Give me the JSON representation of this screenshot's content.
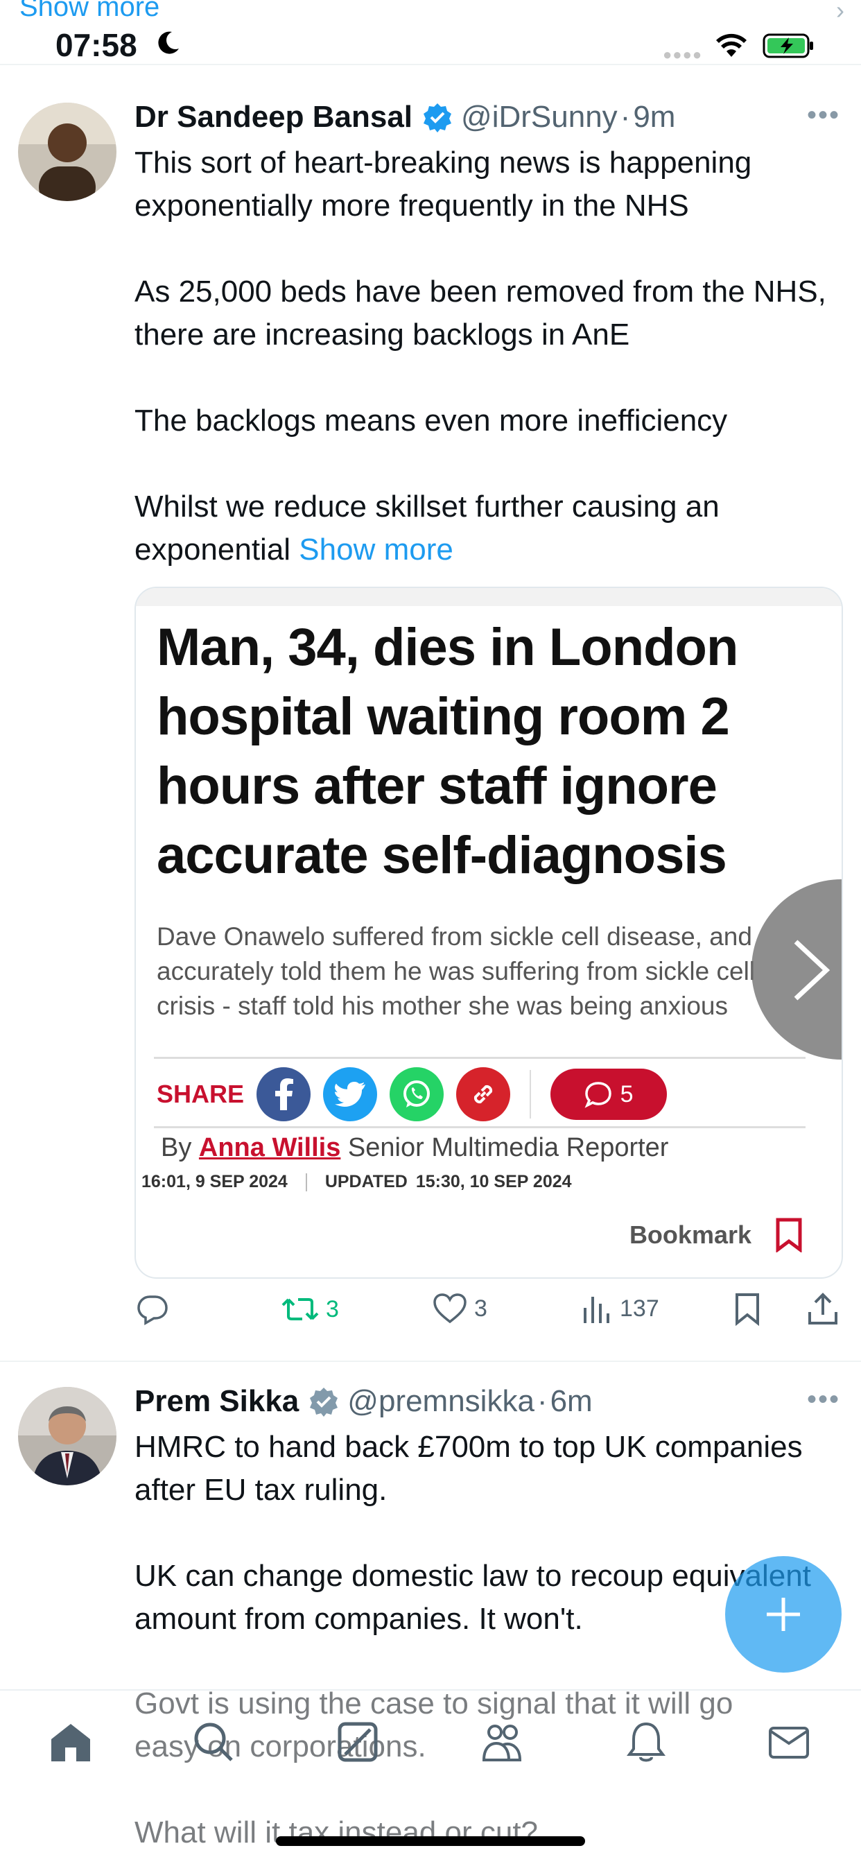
{
  "top_peek": {
    "show_more": "Show more"
  },
  "status_bar": {
    "time": "07:58"
  },
  "tweets": [
    {
      "name": "Dr Sandeep Bansal",
      "handle": "@iDrSunny",
      "dot": "·",
      "time": "9m",
      "paragraphs": [
        "This sort of heart-breaking news is happening exponentially more frequently in the NHS",
        "As 25,000 beds have been removed from the NHS, there are increasing backlogs in AnE",
        "The backlogs means even more inefficiency"
      ],
      "last_paragraph": "Whilst we reduce skillset further causing an exponential ",
      "show_more": "Show more",
      "media": {
        "headline": "Man, 34, dies in London hospital waiting room 2 hours after staff ignore accurate self-diagnosis",
        "subheadline": "Dave Onawelo suffered from sickle cell disease, and accurately told them he was suffering from sickle cell crisis - staff told his mother she was being anxious",
        "share_label": "SHARE",
        "comments_count": "5",
        "byline_prefix": "By ",
        "author": "Anna Willis",
        "author_role": " Senior Multimedia Reporter",
        "published": "16:01, 9 SEP 2024",
        "updated_label": "UPDATED",
        "updated": "15:30, 10 SEP 2024",
        "bookmark_label": "Bookmark"
      },
      "actions": {
        "replies": "",
        "retweets": "3",
        "likes": "3",
        "views": "137"
      }
    },
    {
      "name": "Prem Sikka",
      "handle": "@premnsikka",
      "dot": "·",
      "time": "6m",
      "paragraphs": [
        "HMRC to hand back £700m to top UK companies after EU tax ruling.",
        "UK can change domestic law to recoup equivalent amount from companies. It won't."
      ],
      "faded_lines": [
        "Govt is using the case to signal that it will go",
        "easy on corporations.",
        "What will it tax instead or cut?"
      ]
    }
  ],
  "colors": {
    "accent": "#1d9bf0",
    "retweet": "#00ba7c",
    "article_red": "#c8102e"
  }
}
